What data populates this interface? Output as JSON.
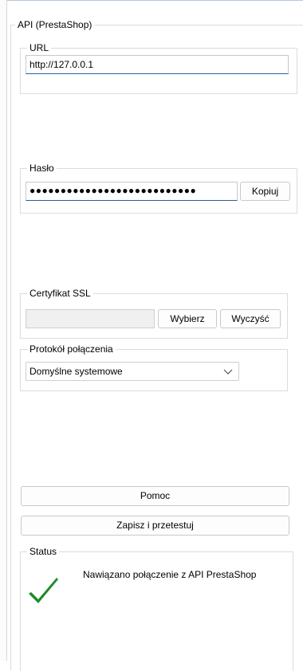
{
  "api_group": {
    "title": "API (PrestaShop)"
  },
  "url_group": {
    "title": "URL",
    "value": "http://127.0.0.1"
  },
  "password_group": {
    "title": "Hasło",
    "value": "●●●●●●●●●●●●●●●●●●●●●●●●●●●",
    "copy_label": "Kopiuj"
  },
  "ssl_group": {
    "title": "Certyfikat SSL",
    "choose_label": "Wybierz",
    "clear_label": "Wyczyść"
  },
  "protocol_group": {
    "title": "Protokół połączenia",
    "selected": "Domyślne systemowe"
  },
  "buttons": {
    "help_label": "Pomoc",
    "save_test_label": "Zapisz i przetestuj"
  },
  "status_group": {
    "title": "Status",
    "message": "Nawiązano połączenie z API PrestaShop",
    "icon": "checkmark-icon",
    "icon_color": "#1f8a2a"
  }
}
